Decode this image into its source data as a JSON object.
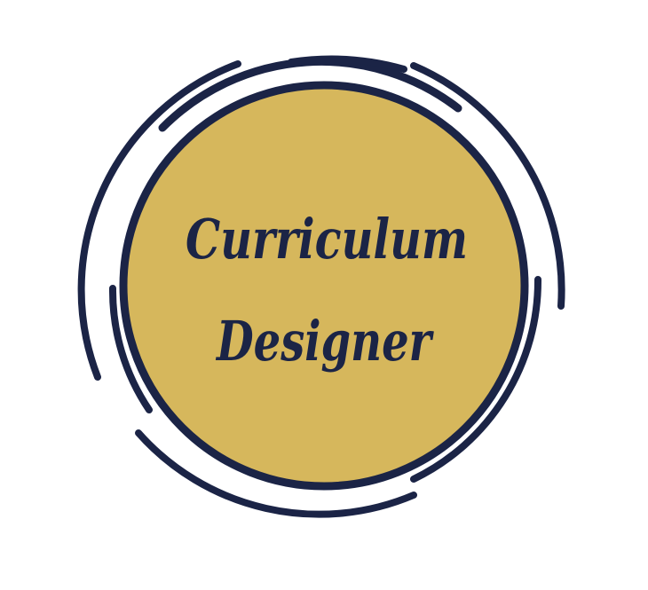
{
  "logo": {
    "line1": "Curriculum",
    "line2": "Designer"
  },
  "colors": {
    "background": "#ffffff",
    "disc_fill": "#d6b75c",
    "ring_navy": "#1b2446",
    "text_navy": "#1b2446"
  }
}
